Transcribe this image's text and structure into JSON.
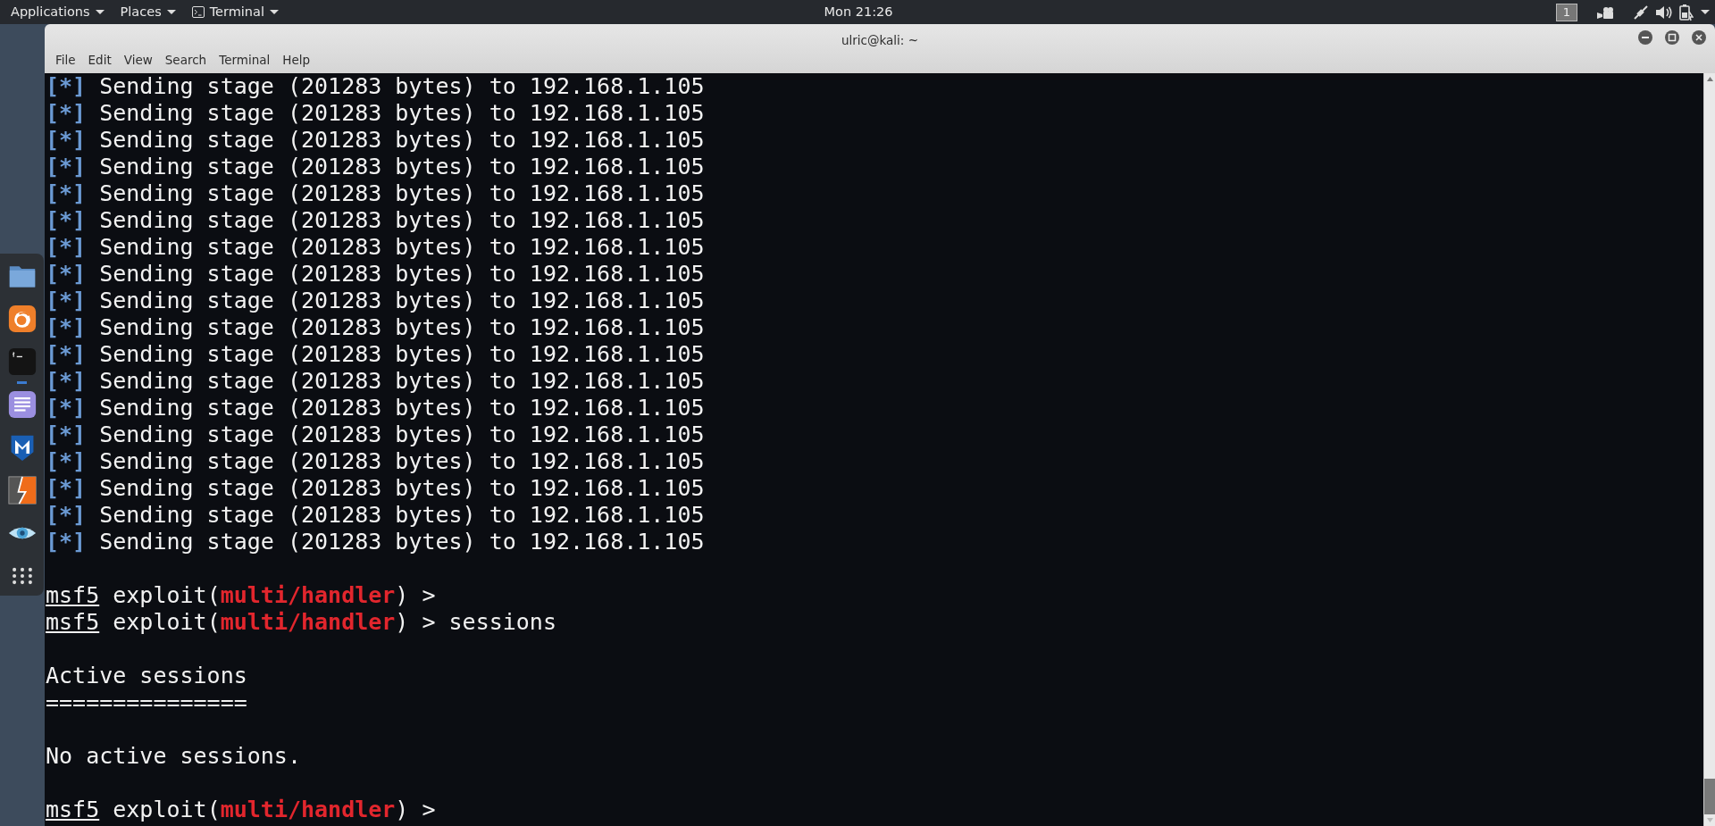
{
  "top_bar": {
    "menus": [
      {
        "label": "Applications",
        "kind": "plain"
      },
      {
        "label": "Places",
        "kind": "plain"
      },
      {
        "label": "Terminal",
        "kind": "terminal"
      }
    ],
    "clock": "Mon 21:26",
    "workspace": "1"
  },
  "dock": {
    "items": [
      {
        "kind": "folder",
        "running": false
      },
      {
        "kind": "browser",
        "running": false
      },
      {
        "kind": "terminal",
        "running": true
      },
      {
        "kind": "notes",
        "running": false
      },
      {
        "kind": "shield",
        "running": false
      },
      {
        "kind": "bolt",
        "running": false
      },
      {
        "kind": "eye",
        "running": false
      },
      {
        "kind": "grid",
        "running": false
      }
    ]
  },
  "window": {
    "title": "ulric@kali: ~",
    "menu": [
      "File",
      "Edit",
      "View",
      "Search",
      "Terminal",
      "Help"
    ]
  },
  "terminal": {
    "lines": [
      {
        "kind": "output",
        "segments": [
          {
            "text": "[*]",
            "kind": "tag"
          },
          {
            "text": " Sending stage (201283 bytes) to 192.168.1.105",
            "kind": "text"
          }
        ]
      },
      {
        "kind": "output",
        "segments": [
          {
            "text": "[*]",
            "kind": "tag"
          },
          {
            "text": " Sending stage (201283 bytes) to 192.168.1.105",
            "kind": "text"
          }
        ]
      },
      {
        "kind": "output",
        "segments": [
          {
            "text": "[*]",
            "kind": "tag"
          },
          {
            "text": " Sending stage (201283 bytes) to 192.168.1.105",
            "kind": "text"
          }
        ]
      },
      {
        "kind": "output",
        "segments": [
          {
            "text": "[*]",
            "kind": "tag"
          },
          {
            "text": " Sending stage (201283 bytes) to 192.168.1.105",
            "kind": "text"
          }
        ]
      },
      {
        "kind": "output",
        "segments": [
          {
            "text": "[*]",
            "kind": "tag"
          },
          {
            "text": " Sending stage (201283 bytes) to 192.168.1.105",
            "kind": "text"
          }
        ]
      },
      {
        "kind": "output",
        "segments": [
          {
            "text": "[*]",
            "kind": "tag"
          },
          {
            "text": " Sending stage (201283 bytes) to 192.168.1.105",
            "kind": "text"
          }
        ]
      },
      {
        "kind": "output",
        "segments": [
          {
            "text": "[*]",
            "kind": "tag"
          },
          {
            "text": " Sending stage (201283 bytes) to 192.168.1.105",
            "kind": "text"
          }
        ]
      },
      {
        "kind": "output",
        "segments": [
          {
            "text": "[*]",
            "kind": "tag"
          },
          {
            "text": " Sending stage (201283 bytes) to 192.168.1.105",
            "kind": "text"
          }
        ]
      },
      {
        "kind": "output",
        "segments": [
          {
            "text": "[*]",
            "kind": "tag"
          },
          {
            "text": " Sending stage (201283 bytes) to 192.168.1.105",
            "kind": "text"
          }
        ]
      },
      {
        "kind": "output",
        "segments": [
          {
            "text": "[*]",
            "kind": "tag"
          },
          {
            "text": " Sending stage (201283 bytes) to 192.168.1.105",
            "kind": "text"
          }
        ]
      },
      {
        "kind": "output",
        "segments": [
          {
            "text": "[*]",
            "kind": "tag"
          },
          {
            "text": " Sending stage (201283 bytes) to 192.168.1.105",
            "kind": "text"
          }
        ]
      },
      {
        "kind": "output",
        "segments": [
          {
            "text": "[*]",
            "kind": "tag"
          },
          {
            "text": " Sending stage (201283 bytes) to 192.168.1.105",
            "kind": "text"
          }
        ]
      },
      {
        "kind": "output",
        "segments": [
          {
            "text": "[*]",
            "kind": "tag"
          },
          {
            "text": " Sending stage (201283 bytes) to 192.168.1.105",
            "kind": "text"
          }
        ]
      },
      {
        "kind": "output",
        "segments": [
          {
            "text": "[*]",
            "kind": "tag"
          },
          {
            "text": " Sending stage (201283 bytes) to 192.168.1.105",
            "kind": "text"
          }
        ]
      },
      {
        "kind": "output",
        "segments": [
          {
            "text": "[*]",
            "kind": "tag"
          },
          {
            "text": " Sending stage (201283 bytes) to 192.168.1.105",
            "kind": "text"
          }
        ]
      },
      {
        "kind": "output",
        "segments": [
          {
            "text": "[*]",
            "kind": "tag"
          },
          {
            "text": " Sending stage (201283 bytes) to 192.168.1.105",
            "kind": "text"
          }
        ]
      },
      {
        "kind": "output",
        "segments": [
          {
            "text": "[*]",
            "kind": "tag"
          },
          {
            "text": " Sending stage (201283 bytes) to 192.168.1.105",
            "kind": "text"
          }
        ]
      },
      {
        "kind": "output",
        "segments": [
          {
            "text": "[*]",
            "kind": "tag"
          },
          {
            "text": " Sending stage (201283 bytes) to 192.168.1.105",
            "kind": "text"
          }
        ]
      },
      {
        "kind": "blank"
      },
      {
        "kind": "prompt",
        "segments": [
          {
            "text": "msf5",
            "kind": "user"
          },
          {
            "text": " exploit(",
            "kind": "text"
          },
          {
            "text": "multi/handler",
            "kind": "module"
          },
          {
            "text": ") >",
            "kind": "text"
          }
        ]
      },
      {
        "kind": "prompt",
        "segments": [
          {
            "text": "msf5",
            "kind": "user"
          },
          {
            "text": " exploit(",
            "kind": "text"
          },
          {
            "text": "multi/handler",
            "kind": "module"
          },
          {
            "text": ") > sessions",
            "kind": "text"
          }
        ]
      },
      {
        "kind": "blank"
      },
      {
        "kind": "output",
        "segments": [
          {
            "text": "Active sessions",
            "kind": "text"
          }
        ]
      },
      {
        "kind": "output",
        "segments": [
          {
            "text": "===============",
            "kind": "text"
          }
        ]
      },
      {
        "kind": "blank"
      },
      {
        "kind": "output",
        "segments": [
          {
            "text": "No active sessions.",
            "kind": "text"
          }
        ]
      },
      {
        "kind": "blank"
      },
      {
        "kind": "prompt",
        "segments": [
          {
            "text": "msf5",
            "kind": "user"
          },
          {
            "text": " exploit(",
            "kind": "text"
          },
          {
            "text": "multi/handler",
            "kind": "module"
          },
          {
            "text": ") >",
            "kind": "text"
          }
        ]
      }
    ]
  }
}
